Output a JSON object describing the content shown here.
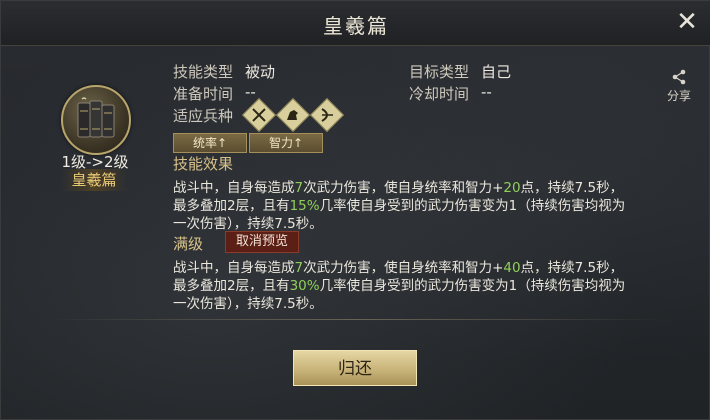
{
  "dialog": {
    "title": "皇羲篇",
    "close_symbol": "✕"
  },
  "skill": {
    "icon": "scroll-book-icon",
    "level_text": "1级->2级",
    "name": "皇羲篇"
  },
  "info": {
    "skill_type_label": "技能类型",
    "skill_type_value": "被动",
    "target_type_label": "目标类型",
    "target_type_value": "自己",
    "prep_time_label": "准备时间",
    "prep_time_value": "--",
    "cooldown_label": "冷却时间",
    "cooldown_value": "--",
    "troop_label": "适应兵种",
    "troop_icons": [
      "spear-icon",
      "cavalry-icon",
      "archer-icon"
    ],
    "attr_tags": [
      "统率↑",
      "智力↑"
    ]
  },
  "effect": {
    "title": "技能效果",
    "line1_a": "战斗中，自身每造成",
    "line1_n": "7",
    "line1_b": "次武力伤害，使自身统率和智力+",
    "line1_v": "20",
    "line1_c": "点，持续7.5秒，",
    "line2_a": "最多叠加2层，且有",
    "line2_p": "15%",
    "line2_b": "几率使自身受到的武力伤害变为1（持续伤害均视为",
    "line3": "一次伤害），持续7.5秒。"
  },
  "max_level": {
    "title": "满级",
    "cancel_preview_label": "取消预览",
    "line1_a": "战斗中，自身每造成",
    "line1_n": "7",
    "line1_b": "次武力伤害，使自身统率和智力+",
    "line1_v": "40",
    "line1_c": "点，持续7.5秒，",
    "line2_a": "最多叠加2层，且有",
    "line2_p": "30%",
    "line2_b": "几率使自身受到的武力伤害变为1（持续伤害均视为",
    "line3": "一次伤害），持续7.5秒。"
  },
  "share": {
    "icon": "share-icon",
    "label": "分享"
  },
  "footer": {
    "return_label": "归还"
  },
  "colors": {
    "highlight": "#8fd05a",
    "gold_text": "#e8c774",
    "button_gold": "#c9b47a",
    "cancel_red": "#5b1f16"
  }
}
